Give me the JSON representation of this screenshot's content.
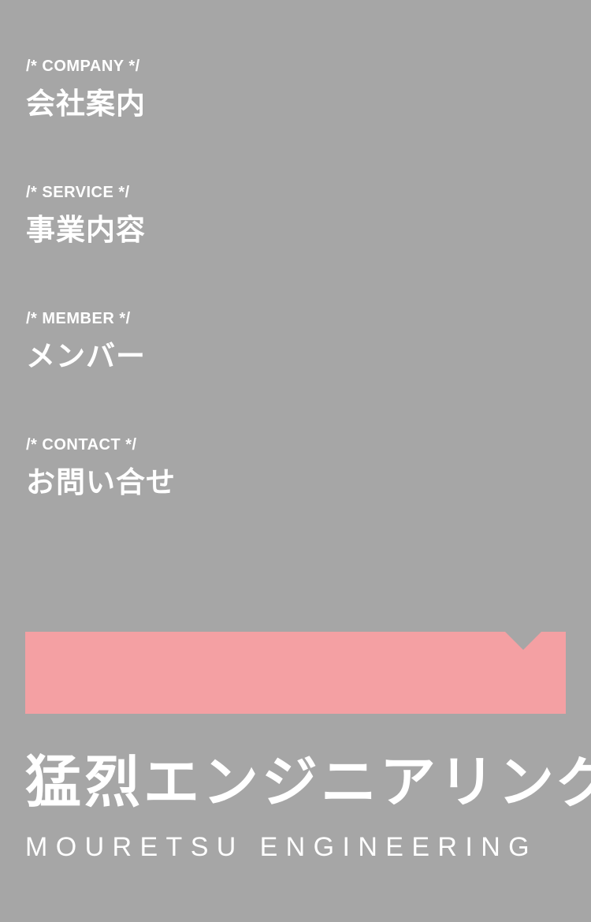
{
  "nav": {
    "items": [
      {
        "sub": "/* COMPANY */",
        "title": "会社案内"
      },
      {
        "sub": "/* SERVICE */",
        "title": "事業内容"
      },
      {
        "sub": "/* MEMBER */",
        "title": "メンバー"
      },
      {
        "sub": "/* CONTACT */",
        "title": "お問い合せ"
      }
    ]
  },
  "logo": {
    "jp": "猛烈エンジニアリング",
    "en": "MOURETSU ENGINEERING"
  },
  "colors": {
    "background": "#a6a6a6",
    "banner": "#f4a0a3",
    "text": "#ffffff"
  }
}
